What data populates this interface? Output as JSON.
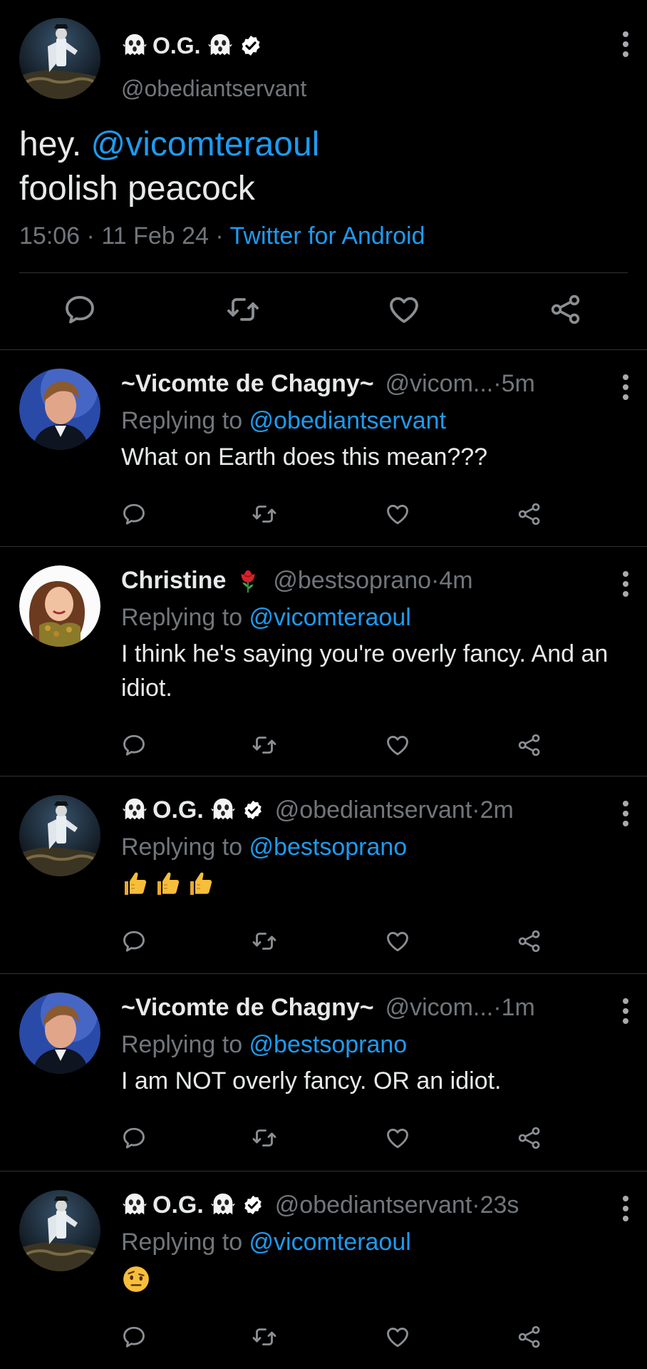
{
  "main_tweet": {
    "display_name": "O.G.",
    "handle": "@obediantservant",
    "text_prefix": "hey. ",
    "mention": "@vicomteraoul",
    "text_line2": "foolish peacock",
    "time": "15:06",
    "dot1": " · ",
    "date": "11 Feb 24",
    "dot2": " · ",
    "source": "Twitter for Android"
  },
  "replies": [
    {
      "display_name": "~Vicomte de Chagny~",
      "handle": "@vicom...",
      "dot": " · ",
      "time": "5m",
      "replying_prefix": "Replying to ",
      "replying_to": "@obediantservant",
      "text": "What on Earth does this mean???"
    },
    {
      "display_name": "Christine",
      "handle": "@bestsoprano",
      "dot": " · ",
      "time": "4m",
      "replying_prefix": "Replying to ",
      "replying_to": "@vicomteraoul",
      "text": "I think he's saying you're overly fancy. And an idiot."
    },
    {
      "display_name": "O.G.",
      "handle": "@obediantservant",
      "dot": " · ",
      "time": "2m",
      "replying_prefix": "Replying to ",
      "replying_to": "@bestsoprano",
      "text_emoji": "thumbs-up x3"
    },
    {
      "display_name": "~Vicomte de Chagny~",
      "handle": "@vicom...",
      "dot": " · ",
      "time": "1m",
      "replying_prefix": "Replying to ",
      "replying_to": "@bestsoprano",
      "text": "I am NOT overly fancy. OR an idiot."
    },
    {
      "display_name": "O.G.",
      "handle": "@obediantservant",
      "dot": " · ",
      "time": "23s",
      "replying_prefix": "Replying to ",
      "replying_to": "@vicomteraoul",
      "text_emoji": "raised-eyebrow face"
    }
  ],
  "icons": {
    "reply": "reply-icon",
    "retweet": "retweet-icon",
    "like": "like-icon",
    "share": "share-icon",
    "more": "more-icon",
    "verified": "verified-icon",
    "ghost": "ghost-emoji",
    "rose": "rose-emoji"
  },
  "colors": {
    "background": "#000000",
    "text": "#e7e9ea",
    "muted": "#71767b",
    "link": "#1d9bf0",
    "divider": "#2f3336"
  }
}
